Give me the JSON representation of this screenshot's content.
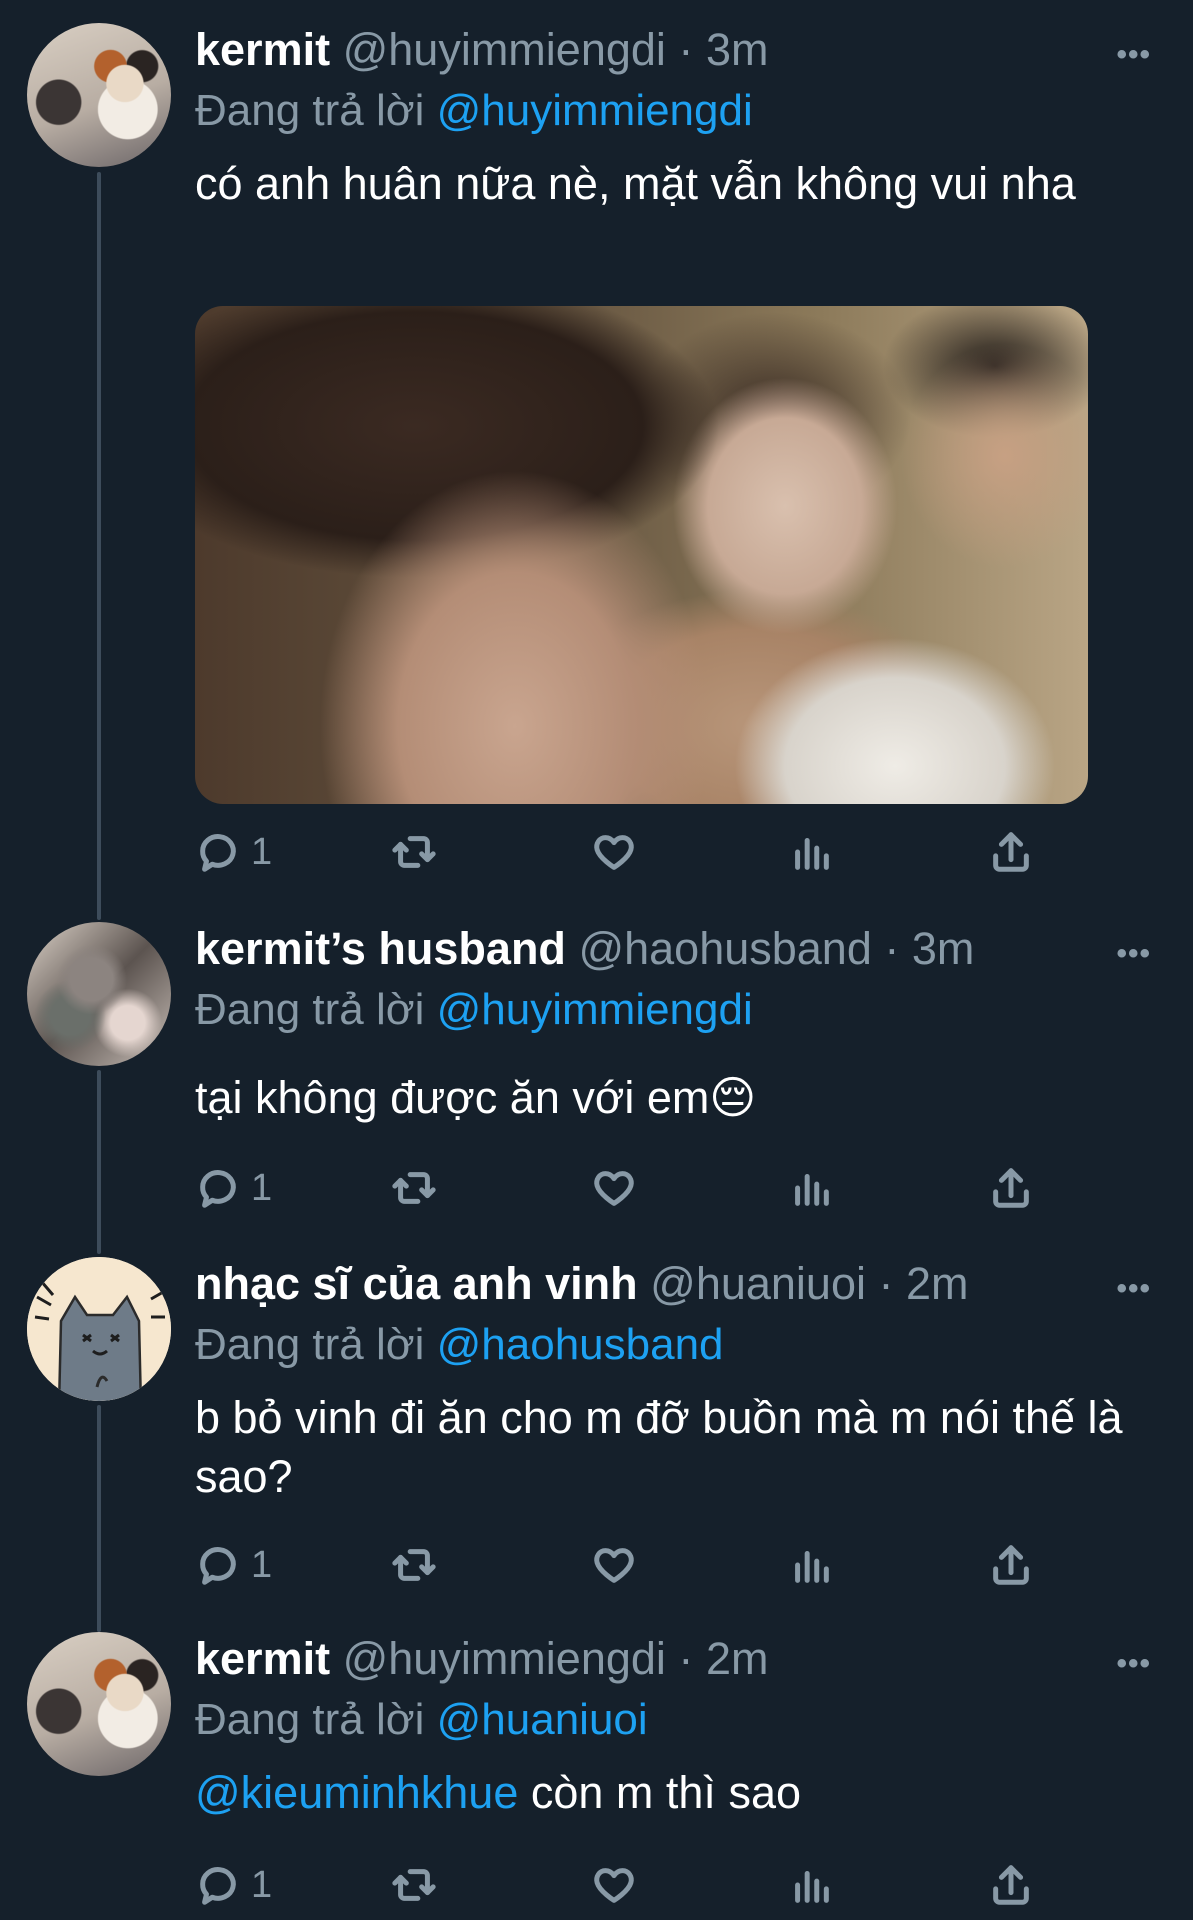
{
  "colors": {
    "background": "#15202b",
    "secondary_text": "#8899a6",
    "link": "#1da1f2",
    "thread_line": "#3d4c5b"
  },
  "tweets": [
    {
      "name": "kermit",
      "handle": "@huyimmiengdi",
      "separator": "·",
      "time": "3m",
      "replying_prefix": "Đang trả lời",
      "replying_to": "@huyimmiengdi",
      "text": "có anh huân nữa nè, mặt vẫn không vui nha",
      "has_media": true,
      "reply_count": "1",
      "avatar": "calico-cat-avatar"
    },
    {
      "name": "kermit’s husband",
      "handle": "@haohusband",
      "separator": "·",
      "time": "3m",
      "replying_prefix": "Đang trả lời",
      "replying_to": "@huyimmiengdi",
      "text": "tại không được ăn với em😔",
      "reply_count": "1",
      "avatar": "blurred-cat-avatar"
    },
    {
      "name": "nhạc sĩ của anh vinh",
      "handle": "@huaniuoi",
      "separator": "·",
      "time": "2m",
      "replying_prefix": "Đang trả lời",
      "replying_to": "@haohusband",
      "text": "b bỏ vinh đi ăn cho m đỡ buồn mà m nói thế là sao?",
      "reply_count": "1",
      "avatar": "drawn-cat-avatar"
    },
    {
      "name": "kermit",
      "handle": "@huyimmiengdi",
      "separator": "·",
      "time": "2m",
      "replying_prefix": "Đang trả lời",
      "replying_to": "@huaniuoi",
      "text_mention": "@kieuminhkhue",
      "text_rest": " còn m thì sao",
      "reply_count": "1",
      "avatar": "calico-cat-avatar"
    }
  ],
  "icons": {
    "more": "more-horizontal-icon",
    "reply": "reply-icon",
    "retweet": "retweet-icon",
    "like": "heart-icon",
    "analytics": "analytics-icon",
    "share": "share-icon"
  }
}
